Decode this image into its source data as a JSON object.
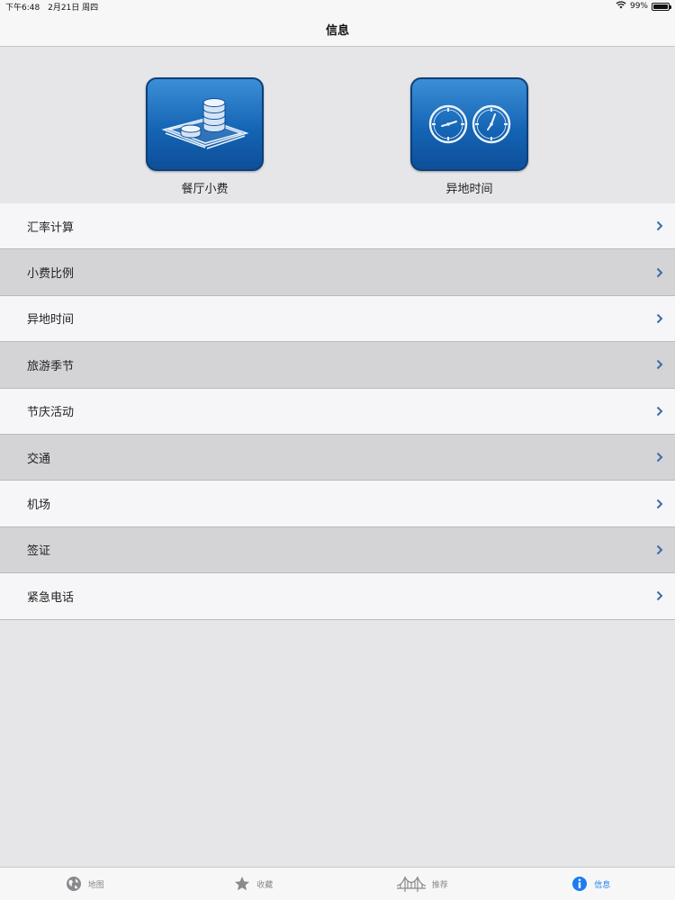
{
  "status_bar": {
    "time": "下午6:48",
    "date": "2月21日 周四",
    "battery": "99%",
    "battery_level": 0.99
  },
  "nav": {
    "title": "信息"
  },
  "tiles": [
    {
      "label": "餐厅小费",
      "icon": "coins-money-icon"
    },
    {
      "label": "异地时间",
      "icon": "clocks-icon"
    }
  ],
  "menu": [
    {
      "label": "汇率计算"
    },
    {
      "label": "小费比例"
    },
    {
      "label": "异地时间"
    },
    {
      "label": "旅游季节"
    },
    {
      "label": "节庆活动"
    },
    {
      "label": "交通"
    },
    {
      "label": "机场"
    },
    {
      "label": "签证"
    },
    {
      "label": "紧急电话"
    }
  ],
  "tabs": [
    {
      "label": "地图",
      "icon": "globe-icon",
      "active": false
    },
    {
      "label": "收藏",
      "icon": "star-icon",
      "active": false
    },
    {
      "label": "推荐",
      "icon": "bridge-icon",
      "active": false
    },
    {
      "label": "信息",
      "icon": "info-icon",
      "active": true
    }
  ],
  "colors": {
    "accent": "#1d7cf2",
    "chevron": "#3a6ea5",
    "tile_blue": "#1565b5",
    "row_shaded": "#d4d3d6",
    "row_plain": "#f6f6f8"
  }
}
